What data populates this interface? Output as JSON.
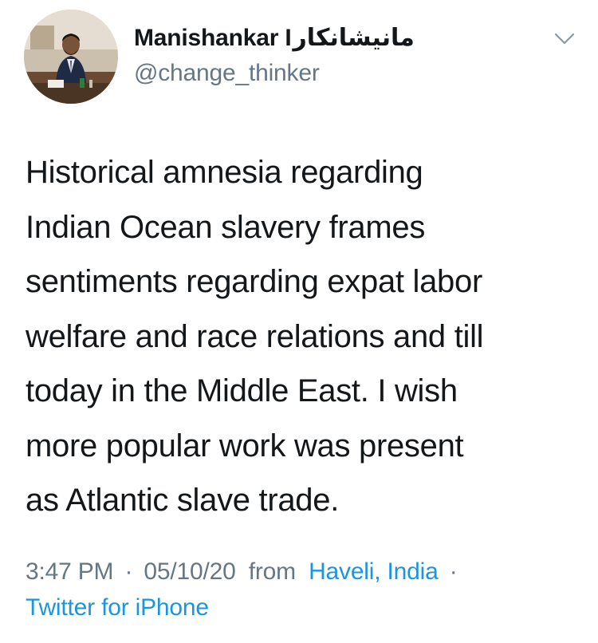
{
  "user": {
    "display_name": "Manishankar I",
    "display_name_urdu": "مانیشانکار",
    "handle": "@change_thinker"
  },
  "tweet": {
    "lines": [
      "Historical amnesia regarding",
      "Indian Ocean slavery frames",
      "sentiments regarding expat labor",
      "welfare and race relations and till",
      "today in the Middle East. I wish",
      "more popular work was present",
      "as Atlantic slave trade."
    ]
  },
  "meta": {
    "time": "3:47 PM",
    "separator": "·",
    "date": "05/10/20",
    "from_label": "from",
    "location": "Haveli, India",
    "separator2": "·",
    "client": "Twitter for iPhone"
  },
  "icons": {
    "menu": "chevron-down-icon"
  },
  "colors": {
    "text": "#14171a",
    "secondary": "#657786",
    "link": "#1b95e0"
  }
}
